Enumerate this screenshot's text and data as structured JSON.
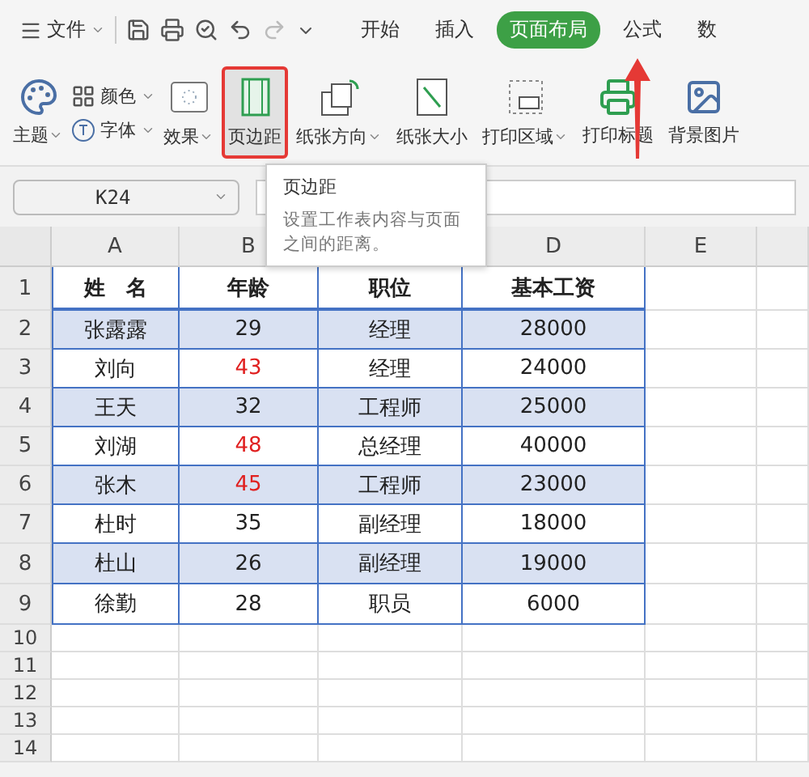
{
  "menu": {
    "file": "文件"
  },
  "tabs": [
    {
      "label": "开始",
      "selected": false
    },
    {
      "label": "插入",
      "selected": false
    },
    {
      "label": "页面布局",
      "selected": true
    },
    {
      "label": "公式",
      "selected": false
    },
    {
      "label": "数",
      "selected": false
    }
  ],
  "ribbon": [
    {
      "label": "主题",
      "kind": "large",
      "dropdown": true,
      "highlighted": false
    },
    {
      "label": "颜色",
      "kind": "small",
      "dropdown": true,
      "highlighted": false
    },
    {
      "label": "字体",
      "kind": "small",
      "dropdown": true,
      "highlighted": false
    },
    {
      "label": "效果",
      "kind": "large",
      "dropdown": true,
      "highlighted": false
    },
    {
      "label": "页边距",
      "kind": "large",
      "dropdown": false,
      "highlighted": true
    },
    {
      "label": "纸张方向",
      "kind": "large",
      "dropdown": true,
      "highlighted": false
    },
    {
      "label": "纸张大小",
      "kind": "large",
      "dropdown": false,
      "highlighted": false
    },
    {
      "label": "打印区域",
      "kind": "large",
      "dropdown": true,
      "highlighted": false
    },
    {
      "label": "打印标题",
      "kind": "large",
      "dropdown": false,
      "highlighted": false
    },
    {
      "label": "背景图片",
      "kind": "large",
      "dropdown": false,
      "highlighted": false
    }
  ],
  "name_box": {
    "value": "K24"
  },
  "tooltip": {
    "title": "页边距",
    "text": "设置工作表内容与页面之间的距离。"
  },
  "sheet": {
    "column_headers": {
      "a": "A",
      "b": "B",
      "d": "D",
      "e": "E"
    },
    "header_row": [
      "姓　名",
      "年龄",
      "职位",
      "基本工资"
    ],
    "rows": [
      {
        "cells": [
          "张露露",
          "29",
          "经理",
          "28000"
        ],
        "age_alert": false
      },
      {
        "cells": [
          "刘向",
          "43",
          "经理",
          "24000"
        ],
        "age_alert": true
      },
      {
        "cells": [
          "王天",
          "32",
          "工程师",
          "25000"
        ],
        "age_alert": false
      },
      {
        "cells": [
          "刘湖",
          "48",
          "总经理",
          "40000"
        ],
        "age_alert": true
      },
      {
        "cells": [
          "张木",
          "45",
          "工程师",
          "23000"
        ],
        "age_alert": true
      },
      {
        "cells": [
          "杜时",
          "35",
          "副经理",
          "18000"
        ],
        "age_alert": false
      },
      {
        "cells": [
          "杜山",
          "26",
          "副经理",
          "19000"
        ],
        "age_alert": false
      },
      {
        "cells": [
          "徐勤",
          "28",
          "职员",
          "6000"
        ],
        "age_alert": false
      }
    ],
    "row_numbers": [
      "1",
      "2",
      "3",
      "4",
      "5",
      "6",
      "7",
      "8",
      "9",
      "10",
      "11",
      "12",
      "13",
      "14"
    ]
  }
}
